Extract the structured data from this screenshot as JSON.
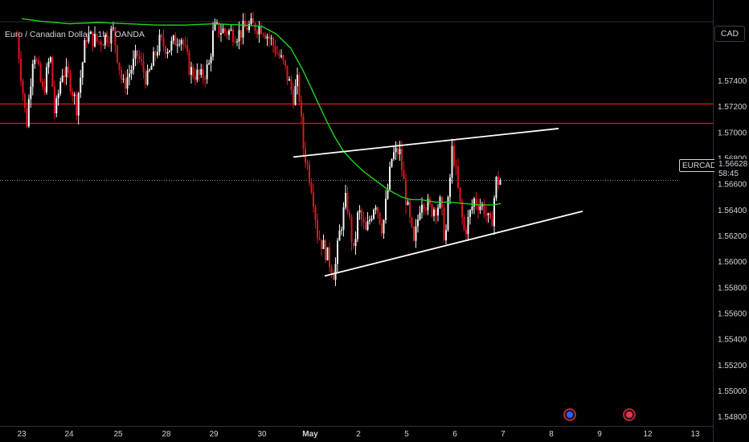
{
  "symbol": {
    "title": "Euro / Canadian Dollar · 1h · OANDA",
    "ticker": "EURCAD",
    "currency": "CAD",
    "last_price": "1.56628",
    "countdown": "58:45"
  },
  "colors": {
    "background": "#000000",
    "up_candle": "#f2f2f2",
    "down_candle": "#e0141e",
    "moving_average": "#1fd31f",
    "horizontal_levels": "#e0141e",
    "trendlines": "#ffffff",
    "axis_text": "#d1d4dc"
  },
  "events": [
    {
      "name": "eu-event-icon",
      "date": "May 8",
      "color": "#2962ff"
    },
    {
      "name": "ca-event-icon",
      "date": "May 10",
      "color": "#f23645"
    }
  ],
  "chart_data": {
    "type": "candlestick",
    "timeframe": "1h",
    "x_ticks": [
      "23",
      "24",
      "25",
      "28",
      "29",
      "30",
      "May",
      "2",
      "5",
      "6",
      "7",
      "8",
      "9",
      "12",
      "13"
    ],
    "y_ticks": [
      "1.57400",
      "1.57200",
      "1.57000",
      "1.56800",
      "1.56600",
      "1.56400",
      "1.56200",
      "1.56000",
      "1.55800",
      "1.55600",
      "1.55400",
      "1.55200",
      "1.55000",
      "1.54800"
    ],
    "ylim": [
      1.5473,
      1.5785
    ],
    "horizontal_levels": [
      1.5722,
      1.5707
    ],
    "last_price": 1.56628,
    "trendlines": [
      {
        "name": "upper",
        "from": {
          "tick": "30",
          "offset": 0.65,
          "price": 1.5681
        },
        "to": {
          "tick": "8",
          "offset": 0.15,
          "price": 1.5703
        }
      },
      {
        "name": "lower",
        "from": {
          "tick": "May",
          "offset": 0.3,
          "price": 1.5589
        },
        "to": {
          "tick": "8",
          "offset": 0.65,
          "price": 1.5639
        }
      }
    ],
    "moving_average_path": [
      [
        0.0,
        1.5788
      ],
      [
        0.4,
        1.5786
      ],
      [
        1.0,
        1.5784
      ],
      [
        1.6,
        1.5785
      ],
      [
        2.2,
        1.5784
      ],
      [
        2.8,
        1.5783
      ],
      [
        3.4,
        1.5783
      ],
      [
        4.0,
        1.5784
      ],
      [
        4.6,
        1.5783
      ],
      [
        5.0,
        1.5782
      ],
      [
        5.3,
        1.5776
      ],
      [
        5.6,
        1.5765
      ],
      [
        5.85,
        1.5748
      ],
      [
        6.1,
        1.5728
      ],
      [
        6.3,
        1.5712
      ],
      [
        6.5,
        1.5697
      ],
      [
        6.7,
        1.5685
      ],
      [
        6.9,
        1.5677
      ],
      [
        7.1,
        1.567
      ],
      [
        7.35,
        1.5663
      ],
      [
        7.6,
        1.5656
      ],
      [
        7.9,
        1.565
      ],
      [
        8.1,
        1.5648
      ],
      [
        8.3,
        1.5648
      ],
      [
        8.6,
        1.5646
      ],
      [
        8.9,
        1.5646
      ],
      [
        9.2,
        1.5645
      ],
      [
        9.5,
        1.5644
      ],
      [
        9.8,
        1.5644
      ],
      [
        9.95,
        1.5645
      ]
    ],
    "candle_keyframes": [
      [
        -0.1,
        1.5775
      ],
      [
        0.1,
        1.5705
      ],
      [
        0.25,
        1.5765
      ],
      [
        0.45,
        1.573
      ],
      [
        0.6,
        1.576
      ],
      [
        0.7,
        1.5712
      ],
      [
        0.85,
        1.5748
      ],
      [
        1.0,
        1.5742
      ],
      [
        1.15,
        1.572
      ],
      [
        1.35,
        1.5775
      ],
      [
        1.6,
        1.577
      ],
      [
        1.9,
        1.5778
      ],
      [
        2.1,
        1.5735
      ],
      [
        2.4,
        1.576
      ],
      [
        2.6,
        1.574
      ],
      [
        2.85,
        1.577
      ],
      [
        3.05,
        1.5765
      ],
      [
        3.3,
        1.5776
      ],
      [
        3.5,
        1.5748
      ],
      [
        3.75,
        1.5742
      ],
      [
        3.9,
        1.5752
      ],
      [
        4.0,
        1.578
      ],
      [
        4.3,
        1.5778
      ],
      [
        4.5,
        1.5776
      ],
      [
        4.7,
        1.5782
      ],
      [
        5.0,
        1.5782
      ],
      [
        5.2,
        1.577
      ],
      [
        5.45,
        1.5752
      ],
      [
        5.65,
        1.5728
      ],
      [
        5.75,
        1.574
      ],
      [
        5.85,
        1.569
      ],
      [
        6.05,
        1.5655
      ],
      [
        6.15,
        1.5622
      ],
      [
        6.35,
        1.5605
      ],
      [
        6.5,
        1.559
      ],
      [
        6.6,
        1.562
      ],
      [
        6.75,
        1.565
      ],
      [
        6.9,
        1.5606
      ],
      [
        7.0,
        1.564
      ],
      [
        7.15,
        1.5622
      ],
      [
        7.35,
        1.5648
      ],
      [
        7.5,
        1.5625
      ],
      [
        7.7,
        1.5682
      ],
      [
        7.85,
        1.5686
      ],
      [
        8.0,
        1.5645
      ],
      [
        8.15,
        1.5612
      ],
      [
        8.3,
        1.565
      ],
      [
        8.5,
        1.564
      ],
      [
        8.7,
        1.5645
      ],
      [
        8.8,
        1.5615
      ],
      [
        8.95,
        1.569
      ],
      [
        9.1,
        1.5645
      ],
      [
        9.2,
        1.5622
      ],
      [
        9.4,
        1.5648
      ],
      [
        9.6,
        1.5642
      ],
      [
        9.75,
        1.5625
      ],
      [
        9.85,
        1.5662
      ],
      [
        9.95,
        1.5663
      ]
    ]
  }
}
